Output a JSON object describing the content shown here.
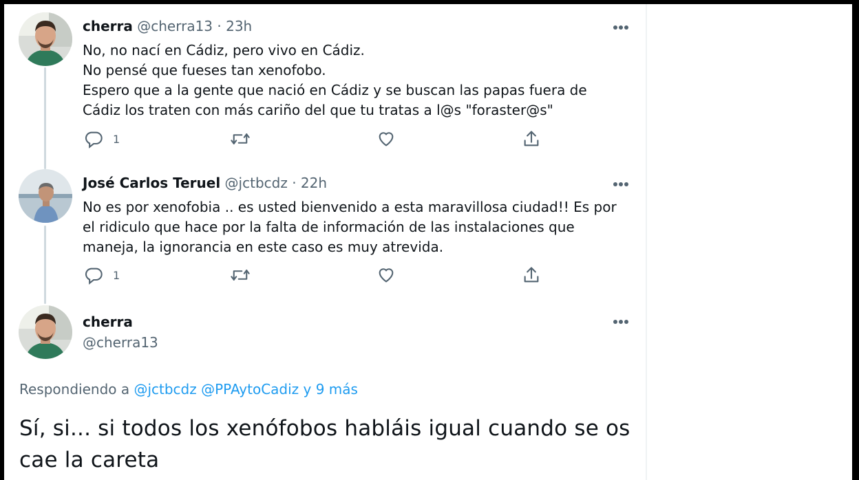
{
  "tweets": [
    {
      "name": "cherra",
      "handle": "@cherra13",
      "dot": "·",
      "time": "23h",
      "lines": [
        "No, no nací en Cádiz, pero vivo en Cádiz.",
        "No pensé que fueses tan xenofobo.",
        "Espero que a la gente que nació en Cádiz y se buscan las papas fuera de",
        "Cádiz los traten con más cariño del que tu tratas a l@s \"foraster@s\""
      ],
      "reply_count": "1"
    },
    {
      "name": "José Carlos Teruel",
      "handle": "@jctbcdz",
      "dot": "·",
      "time": "22h",
      "lines": [
        "No es por xenofobia .. es usted bienvenido a esta maravillosa ciudad!! Es por",
        "el ridiculo que hace por la falta de información de las instalaciones que",
        "maneja, la ignorancia en este caso es muy atrevida."
      ],
      "reply_count": "1"
    }
  ],
  "main_tweet": {
    "name": "cherra",
    "handle": "@cherra13",
    "replying_prefix": "Respondiendo a",
    "replying_mentions": [
      "@jctbcdz",
      "@PPAytoCadiz",
      "y 9 más"
    ],
    "text_lines": [
      "Sí, si... si todos los xenófobos habláis igual cuando se os",
      "cae la careta"
    ]
  },
  "colors": {
    "text": "#0f1419",
    "secondary": "#536471",
    "link": "#1d9bf0",
    "thread_line": "#cfd9de"
  },
  "icons": [
    "reply-icon",
    "retweet-icon",
    "like-icon",
    "share-icon",
    "more-icon"
  ]
}
